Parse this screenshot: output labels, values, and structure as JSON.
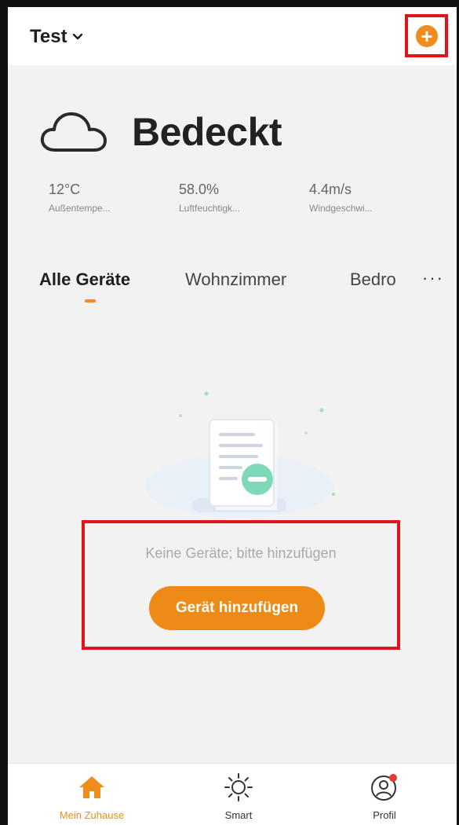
{
  "header": {
    "home_name": "Test"
  },
  "weather": {
    "condition": "Bedeckt"
  },
  "stats": [
    {
      "value": "12°C",
      "label": "Außentempe..."
    },
    {
      "value": "58.0%",
      "label": "Luftfeuchtigk..."
    },
    {
      "value": "4.4m/s",
      "label": "Windgeschwi..."
    }
  ],
  "tabs": [
    {
      "label": "Alle Geräte"
    },
    {
      "label": "Wohnzimmer"
    },
    {
      "label": "Bedro"
    }
  ],
  "tabs_more": "···",
  "empty_state": {
    "message": "Keine Geräte; bitte hinzufügen",
    "button": "Gerät hinzufügen"
  },
  "bottom_nav": [
    {
      "label": "Mein Zuhause",
      "icon": "home-icon"
    },
    {
      "label": "Smart",
      "icon": "sun-icon"
    },
    {
      "label": "Profil",
      "icon": "profile-icon"
    }
  ],
  "colors": {
    "accent": "#F08C1E",
    "highlight_box": "#E2141B",
    "notification_dot": "#E53935"
  }
}
